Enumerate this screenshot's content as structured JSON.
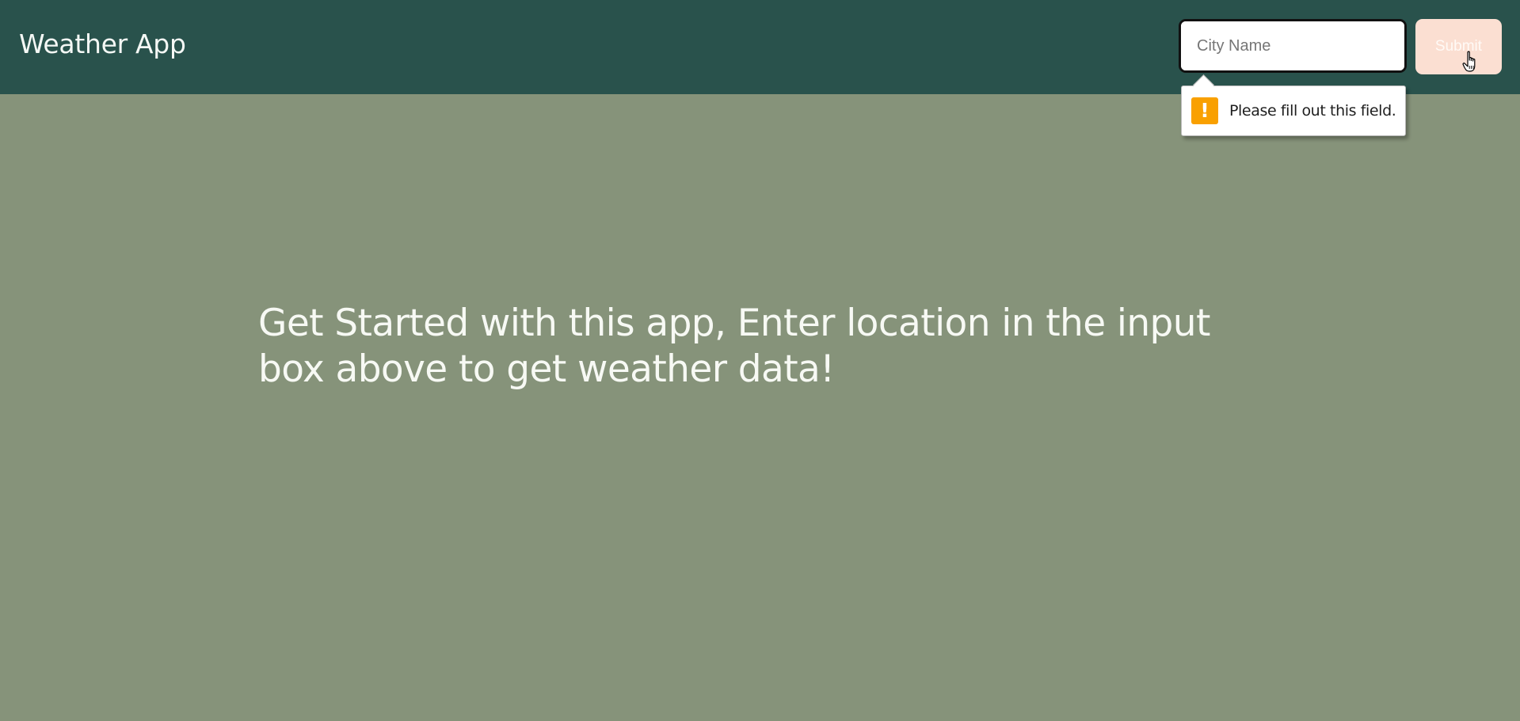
{
  "header": {
    "title": "Weather App",
    "background_color": "#29524c"
  },
  "search": {
    "placeholder": "City Name",
    "value": "",
    "submit_label": "Submit",
    "submit_color": "#fbdfd2"
  },
  "validation_tooltip": {
    "message": "Please fill out this field.",
    "icon": "warning-icon",
    "icon_color": "#f9a000"
  },
  "main": {
    "intro_message": "Get Started with this app, Enter location in the input box above to get weather data!",
    "background_color": "#86937a"
  },
  "cursor": {
    "icon": "hand-pointer-icon"
  }
}
